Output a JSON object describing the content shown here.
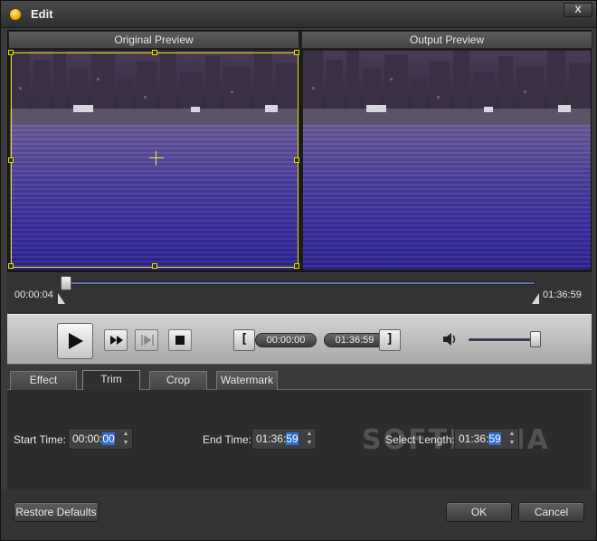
{
  "window": {
    "title": "Edit",
    "close_label": "X"
  },
  "preview": {
    "original_label": "Original Preview",
    "output_label": "Output Preview"
  },
  "timeline": {
    "start_time": "00:00:04",
    "end_time": "01:36:59",
    "position_fraction": 0.0
  },
  "controls": {
    "trim_start": "00:00:00",
    "trim_end": "01:36:59",
    "start_bracket": "[",
    "end_bracket": "]",
    "volume_fraction": 0.95
  },
  "tabs": [
    {
      "label": "Effect",
      "active": false
    },
    {
      "label": "Trim",
      "active": true
    },
    {
      "label": "Crop",
      "active": false
    },
    {
      "label": "Watermark",
      "active": false
    }
  ],
  "trim": {
    "start_label": "Start Time:",
    "start_value_prefix": "00:00:",
    "start_value_selected": "00",
    "end_label": "End Time:",
    "end_value_prefix": "01:36:",
    "end_value_selected": "59",
    "length_label": "Select Length:",
    "length_value_prefix": "01:36:",
    "length_value_selected": "59"
  },
  "overlay_watermark": "SOFTPEDIA",
  "footer": {
    "restore_label": "Restore Defaults",
    "ok_label": "OK",
    "cancel_label": "Cancel"
  },
  "colors": {
    "crop_frame": "#e8e000",
    "track": "#5c76b6",
    "selection": "#2f6fd0"
  }
}
